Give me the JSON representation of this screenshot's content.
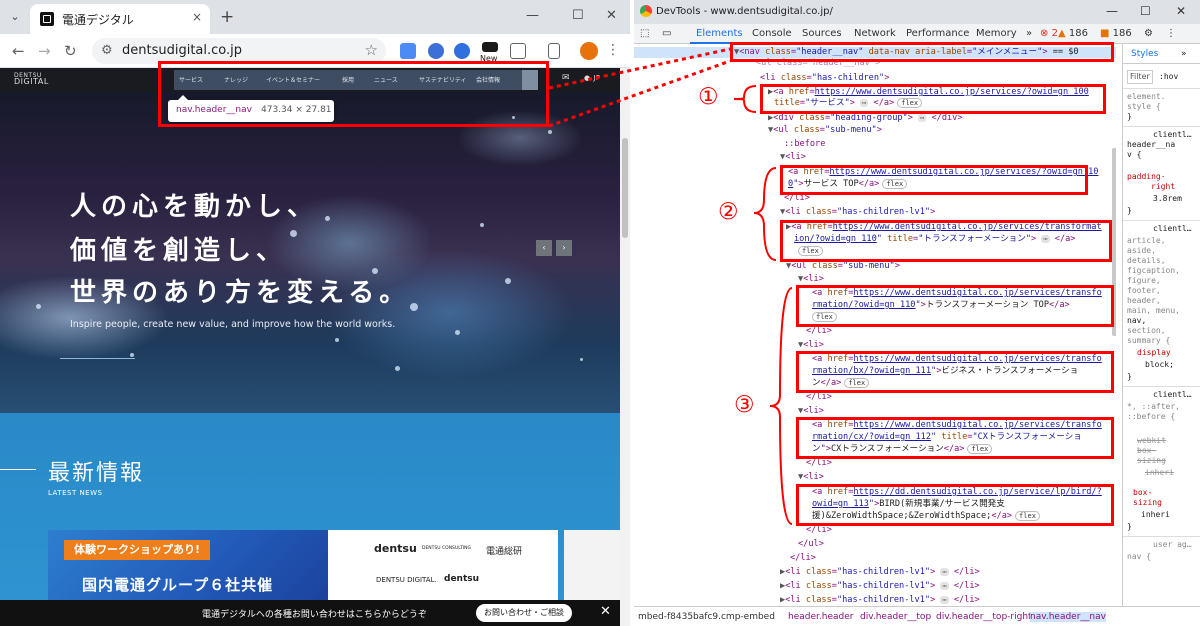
{
  "browser": {
    "tab_title": "電通デジタル",
    "tab_close": "×",
    "new_tab": "+",
    "url": "dentsudigital.co.jp",
    "ext_label": "New",
    "icons": [
      "back-icon",
      "forward-icon",
      "reload-icon",
      "tune-icon",
      "star-icon",
      "extensions-icon"
    ]
  },
  "site": {
    "logo_top": "DENTSU",
    "logo_bottom": "DIGITAL",
    "nav": [
      "サービス",
      "ナレッジ",
      "イベント＆セミナー",
      "採用",
      "ニュース",
      "サステナビリティ",
      "会社情報"
    ],
    "lang": "● JP",
    "tooltip_name": "nav.header__nav",
    "tooltip_size": "473.34 × 27.81",
    "hero_lines": [
      "人の心を動かし、",
      "価値を創造し、",
      "世界のあり方を変える。"
    ],
    "hero_en": "Inspire people, create new value, and improve how the world works.",
    "prev": "‹",
    "next": "›",
    "news_title": "最新情報",
    "news_sub": "LATEST NEWS",
    "badge": "体験ワークショップあり!",
    "card_heading": "国内電通グループ６社共催",
    "brands": [
      "dentsu",
      "DENTSU CONSULTING",
      "電通総研",
      "DENTSU DIGITAL.",
      "dentsu"
    ],
    "footer_text": "電通デジタルへの各種お問い合わせはこちらからどうぞ",
    "footer_button": "お問い合わせ・ご相談",
    "footer_close": "✕"
  },
  "devtools": {
    "title": "DevTools - www.dentsudigital.co.jp/",
    "tabs": [
      "Elements",
      "Console",
      "Sources",
      "Network",
      "Performance",
      "Memory"
    ],
    "more": "»",
    "errors": "2",
    "warnings": "186",
    "issues": "186",
    "styles_tabs": [
      "Styles",
      "»"
    ],
    "filter": "Filter",
    "hov": ":hov",
    "links": {
      "services": "https://www.dentsudigital.co.jp/services/?owid=gn_100",
      "services_top_a": "https://www.dentsudigital.co.jp/services/?owid=gn_10",
      "services_top_b": "0",
      "transform_a": "https://www.dentsudigital.co.jp/services/transformat",
      "transform_b": "ion/?owid=gn_110",
      "t_top_a": "https://www.dentsudigital.co.jp/services/transfo",
      "t_top_b": "rmation/?owid=gn_110",
      "bx_a": "https://www.dentsudigital.co.jp/services/transfo",
      "bx_b": "rmation/bx/?owid=gn_111",
      "cx_a": "https://www.dentsudigital.co.jp/services/transfo",
      "cx_b": "rmation/cx/?owid=gn_112",
      "bird_a": "https://dd.dentsudigital.co.jp/service/lp/bird/?",
      "bird_b": "owid=gn_113"
    },
    "text": {
      "nav_class": "\"header__nav\"",
      "nav_label": "\"メインメニュー\"",
      "nav_eq": "== $0",
      "services_title": "\"サービス\"",
      "services_top": "サービス TOP",
      "transform_title": "\"トランスフォーメーション\"",
      "t_top": "トランスフォーメーション TOP",
      "bx_text_a": "ビジネス・トランスフォーメーショ",
      "bx_text_b": "ン",
      "cx_title_a": "\"CXトランスフォーメーショ",
      "cx_title_b": "ン\"",
      "cx_text": "CXトランスフォーメーション",
      "bird_text_a": "BIRD(新規事業/サービス開発支",
      "bird_text_b": "援)&ZeroWidthSpace;&ZeroWidthSpace;",
      "flex": "flex",
      "ell": "⋯",
      "before": "::before"
    },
    "breadcrumbs": [
      "mbed-f8435bafc9.cmp-embed",
      "header.header",
      "div.header__top",
      "div.header__top-right",
      "nav.header__nav"
    ],
    "styles_lines": [
      "element.",
      "style {",
      "}",
      "clientl…",
      "header__na",
      "v {",
      "padding-",
      "right",
      "3.8rem",
      "}",
      "clientl…",
      "article,",
      "aside,",
      "details,",
      "figcaption,",
      "figure,",
      "footer,",
      "header,",
      "main, menu,",
      "nav,",
      "section,",
      "summary {",
      "display",
      "block;",
      "}",
      "clientl…",
      "*, ::after,",
      "::before {",
      "webkit",
      "box-",
      "sizing",
      "inheri",
      "box-",
      "sizing",
      "inheri",
      "}",
      "user ag…",
      "nav {"
    ]
  },
  "annotations": [
    "①",
    "②",
    "③"
  ],
  "colors": {
    "accent": "#ff0000",
    "devtools_blue": "#1a73e8",
    "tag": "#881280",
    "attr_value": "#1a1aa6",
    "badge": "#ef7f1a",
    "news_bg": "#2a89c8"
  }
}
